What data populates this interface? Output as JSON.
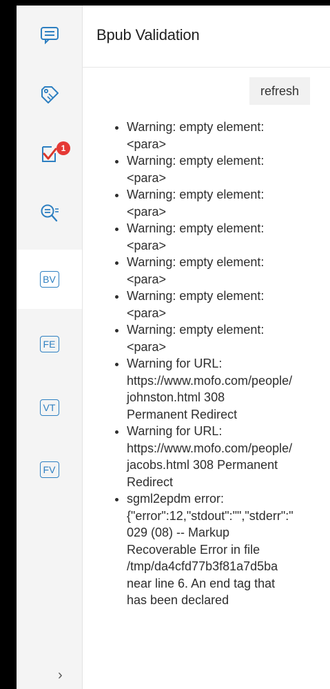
{
  "panel": {
    "title": "Bpub Validation",
    "refresh_label": "refresh"
  },
  "rail": {
    "items": [
      {
        "name": "comments",
        "icon": "comment-icon"
      },
      {
        "name": "tags",
        "icon": "tag-icon"
      },
      {
        "name": "tasks",
        "icon": "task-check-icon",
        "badge": "1"
      },
      {
        "name": "search",
        "icon": "search-list-icon"
      },
      {
        "name": "bpub-validation",
        "label": "BV",
        "active": true
      },
      {
        "name": "fe",
        "label": "FE"
      },
      {
        "name": "vt",
        "label": "VT"
      },
      {
        "name": "fv",
        "label": "FV"
      }
    ],
    "expand_icon": "chevron-right-icon"
  },
  "messages": [
    {
      "text": "Warning: empty element:\n<para>"
    },
    {
      "text": "Warning: empty element:\n<para>"
    },
    {
      "text": "Warning: empty element:\n<para>"
    },
    {
      "text": "Warning: empty element:\n<para>"
    },
    {
      "text": "Warning: empty element:\n<para>"
    },
    {
      "text": "Warning: empty element:\n<para>"
    },
    {
      "text": "Warning: empty element:\n<para>"
    },
    {
      "text": "Warning for URL:\nhttps://www.mofo.com/people/\njohnston.html 308\nPermanent Redirect"
    },
    {
      "text": "Warning for URL:\nhttps://www.mofo.com/people/\njacobs.html 308 Permanent\nRedirect"
    },
    {
      "text": "sgml2epdm error:\n{\"error\":12,\"stdout\":\"\",\"stderr\":\"\n029 (08) -- Markup\nRecoverable Error in file\n/tmp/da4cfd77b3f81a7d5ba\nnear line 6. An end tag that\nhas been declared"
    }
  ],
  "colors": {
    "accent": "#2d7fc1",
    "badge": "#e53935",
    "task_check": "#d9372b"
  }
}
